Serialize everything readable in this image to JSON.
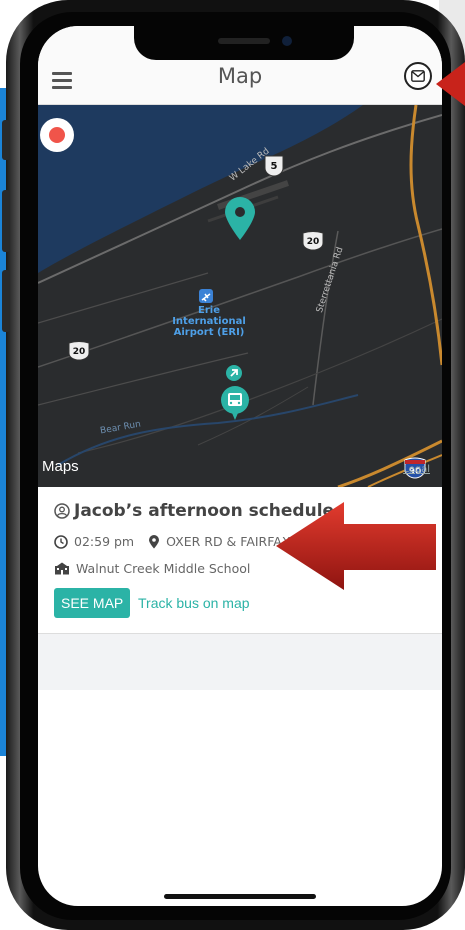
{
  "header": {
    "title": "Map",
    "menu_icon": "hamburger-menu-icon",
    "mail_icon": "envelope-icon"
  },
  "map": {
    "record_icon": "record-dot-icon",
    "airport_label_lines": [
      "Erie",
      "International",
      "Airport (ERI)"
    ],
    "roads": {
      "w_lake_rd": "W Lake Rd",
      "sterrettania_rd": "Sterrettania Rd",
      "bear_run": "Bear Run"
    },
    "shields": {
      "route_5": "5",
      "route_20_a": "20",
      "route_20_b": "20",
      "route_90": "90"
    },
    "brand": "Maps",
    "legal": "Legal",
    "colors": {
      "water": "#1e3a5f",
      "land": "#2a2c2e",
      "highway": "#c9892e",
      "pin": "#2bb3a6"
    }
  },
  "schedule": {
    "title": "Jacob’s afternoon schedule",
    "time": "02:59 pm",
    "stop": "OXER RD & FAIRFAX AVE",
    "school": "Walnut Creek Middle School",
    "see_map_label": "SEE MAP",
    "track_label": "Track bus on map",
    "accent": "#2bb3a6"
  }
}
